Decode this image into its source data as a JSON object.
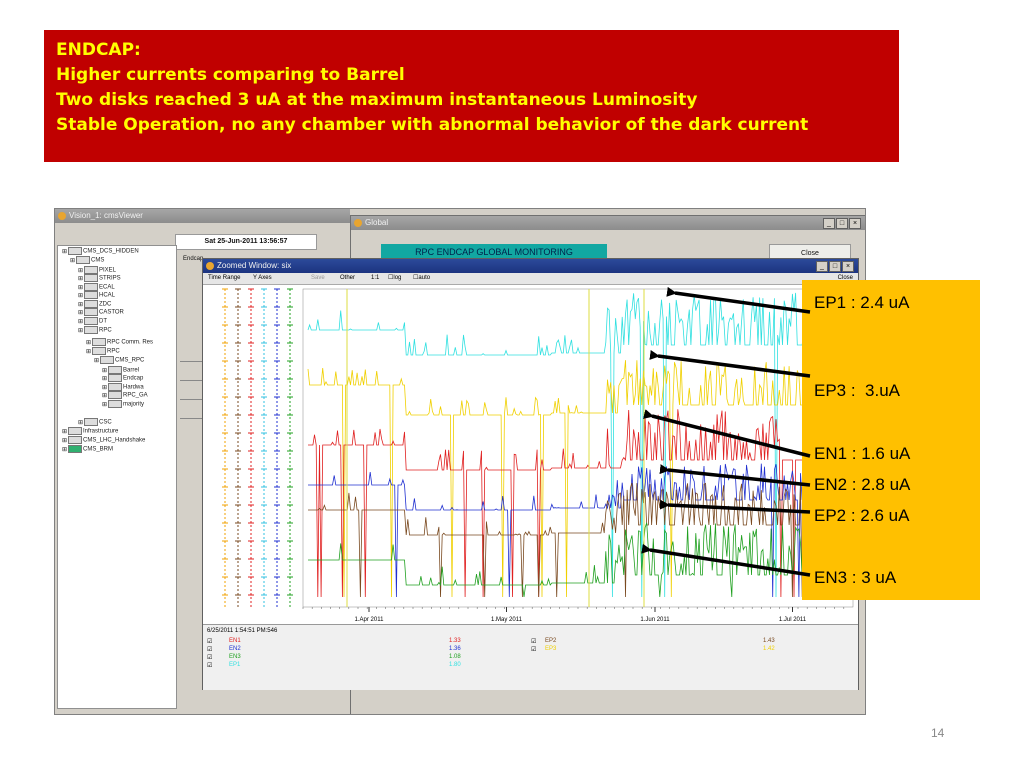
{
  "banner": {
    "lines": [
      "ENDCAP:",
      "Higher currents comparing to Barrel",
      "Two disks reached 3 uA at the maximum instantaneous  Luminosity",
      "Stable Operation, no any chamber with abnormal behavior of the dark current"
    ]
  },
  "screenshot": {
    "main_title": "Vision_1: cmsViewer",
    "date_box": "Sat  25-Jun-2011      13:56:57",
    "endcap_label": "Endcap",
    "tree": [
      "CMS_DCS_HIDDEN",
      "CMS",
      "PIXEL",
      "STRIPS",
      "ECAL",
      "HCAL",
      "ZDC",
      "CASTOR",
      "DT",
      "RPC",
      "RPC Comm. Res",
      "RPC",
      "CMS_RPC",
      "Barrel",
      "Endcap",
      "Hardwa",
      "RPC_GA",
      "majority",
      "CSC",
      "Infrastructure",
      "CMS_LHC_Handshake",
      "CMS_BRM"
    ],
    "global_window": {
      "title": "Global",
      "banner": "RPC ENDCAP GLOBAL MONITORING",
      "close_label": "Close"
    },
    "zoomed_window": {
      "title": "Zoomed Window: six",
      "toolbar": [
        "Time Range",
        "Y Axes",
        "Save",
        "Other",
        "1:1",
        "log",
        "auto"
      ],
      "close_label": "Close",
      "x_ticks": [
        "1.Apr 2011",
        "1.May 2011",
        "1.Jun 2011",
        "1.Jul 2011"
      ],
      "timestamp": "6/25/2011 1:54:51 PM:546",
      "legend_left": [
        {
          "name": "EN1",
          "value": "1.33",
          "color": "#e02020"
        },
        {
          "name": "EN2",
          "value": "1.36",
          "color": "#2030d0"
        },
        {
          "name": "EN3",
          "value": "1.08",
          "color": "#20a020"
        },
        {
          "name": "EP1",
          "value": "1.80",
          "color": "#30e0e0"
        }
      ],
      "legend_right": [
        {
          "name": "EP2",
          "value": "1.43",
          "color": "#7a4a20"
        },
        {
          "name": "EP3",
          "value": "1.42",
          "color": "#f0d000"
        }
      ]
    }
  },
  "callout": {
    "items": [
      {
        "key": "ep1",
        "text": "EP1 : 2.4 uA",
        "color": "#30e0e0"
      },
      {
        "key": "ep3",
        "text": "EP3 :  3.uA",
        "color": "#f0d000"
      },
      {
        "key": "en1",
        "text": "EN1 : 1.6 uA",
        "color": "#e02020"
      },
      {
        "key": "en2",
        "text": "EN2 : 2.8 uA",
        "color": "#2030d0"
      },
      {
        "key": "ep2",
        "text": "EP2 : 2.6 uA",
        "color": "#7a4a20"
      },
      {
        "key": "en3",
        "text": "EN3 : 3 uA",
        "color": "#20a020"
      }
    ]
  },
  "slide_number": "14"
}
